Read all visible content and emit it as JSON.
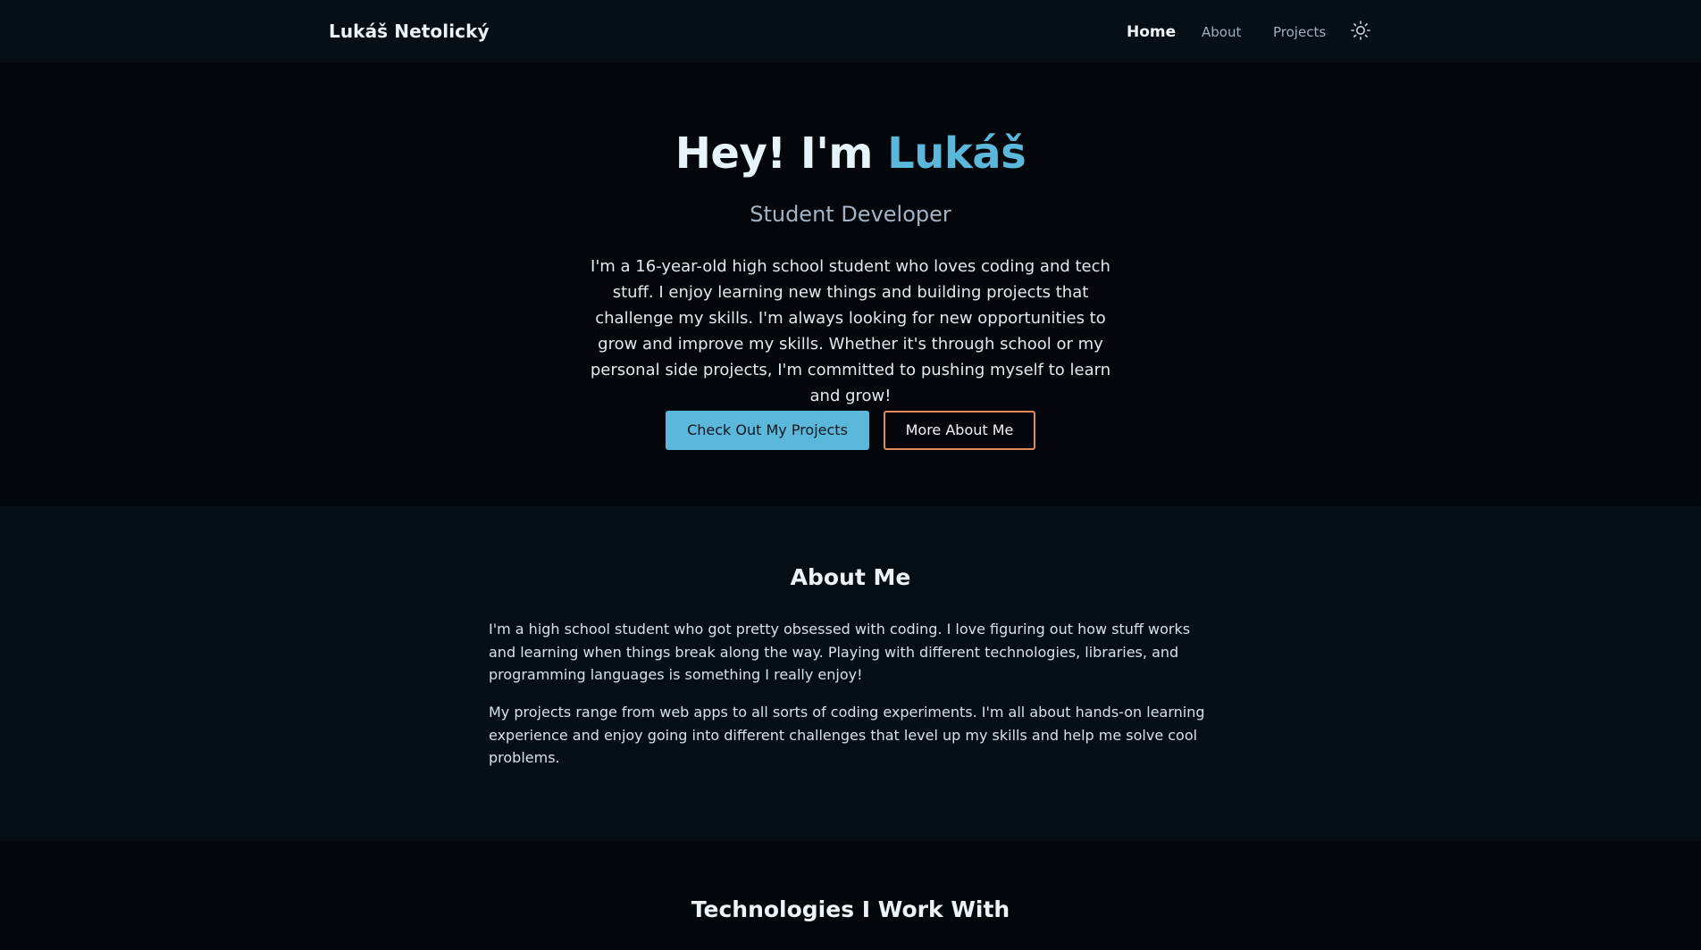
{
  "nav": {
    "brand": "Lukáš Netolický",
    "links": [
      {
        "label": "Home",
        "active": true
      },
      {
        "label": "About",
        "active": false
      },
      {
        "label": "Projects",
        "active": false
      }
    ],
    "theme_toggle_icon": "sun-icon"
  },
  "hero": {
    "title_prefix": "Hey! I'm ",
    "title_name": "Lukáš",
    "subtitle": "Student Developer",
    "bio": "I'm a 16-year-old high school student who loves coding and tech stuff. I enjoy learning new things and building projects that challenge my skills. I'm always looking for new opportunities to grow and improve my skills. Whether it's through school or my personal side projects, I'm committed to pushing myself to learn and grow!",
    "primary_button": "Check Out My Projects",
    "secondary_button": "More About Me"
  },
  "about": {
    "title": "About Me",
    "paragraphs": [
      "I'm a high school student who got pretty obsessed with coding. I love figuring out how stuff works and learning when things break along the way. Playing with different technologies, libraries, and programming languages is something I really enjoy!",
      "My projects range from web apps to all sorts of coding experiments. I'm all about hands-on learning experience and enjoy going into different challenges that level up my skills and help me solve cool problems."
    ]
  },
  "technologies": {
    "title": "Technologies I Work With"
  },
  "colors": {
    "accent": "#5bb8db",
    "secondary_border": "#e38a5a",
    "background": "#03070b",
    "section_alt": "#060e15"
  }
}
